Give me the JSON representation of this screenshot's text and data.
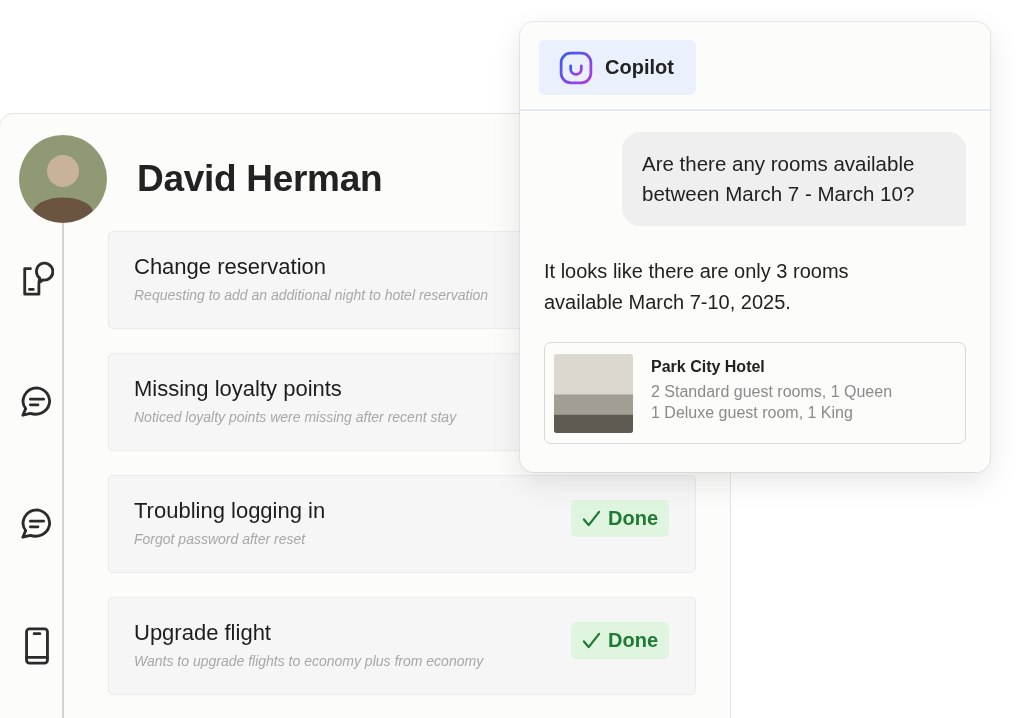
{
  "profile": {
    "name": "David Herman"
  },
  "tickets": [
    {
      "kind": "phone-chat",
      "title": "Change reservation",
      "subtitle": "Requesting to add an additional night to hotel reservation"
    },
    {
      "kind": "chat",
      "title": "Missing loyalty points",
      "subtitle": "Noticed loyalty points were missing after recent stay"
    },
    {
      "kind": "chat",
      "title": "Troubling logging in",
      "subtitle": "Forgot password after reset",
      "badge": "Done"
    },
    {
      "kind": "phone",
      "title": "Upgrade flight",
      "subtitle": "Wants to upgrade flights to economy plus from economy",
      "badge": "Done"
    }
  ],
  "copilot": {
    "title": "Copilot",
    "messages": [
      {
        "kind": "user",
        "text": "Are there any rooms available between March 7 - March 10?"
      },
      {
        "kind": "assistant",
        "text": "It looks like there are only 3 rooms available March 7-10, 2025."
      }
    ],
    "hotel": {
      "name": "Park City Hotel",
      "lines": [
        "2 Standard guest rooms, 1 Queen",
        "1 Deluxe guest room, 1 King"
      ]
    }
  }
}
